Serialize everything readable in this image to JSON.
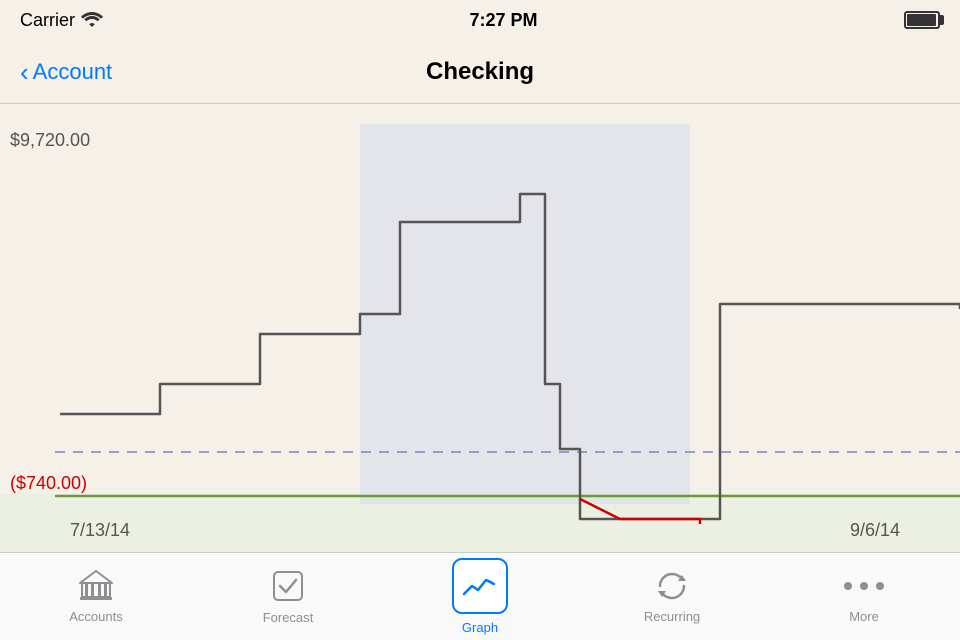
{
  "status": {
    "carrier": "Carrier",
    "wifi": "📶",
    "time": "7:27 PM"
  },
  "nav": {
    "back_label": "Account",
    "title": "Checking"
  },
  "chart": {
    "y_max": "$9,720.00",
    "y_min": "($740.00)",
    "x_start": "7/13/14",
    "x_end": "9/6/14"
  },
  "tabs": [
    {
      "id": "accounts",
      "label": "Accounts",
      "active": false
    },
    {
      "id": "forecast",
      "label": "Forecast",
      "active": false
    },
    {
      "id": "graph",
      "label": "Graph",
      "active": true
    },
    {
      "id": "recurring",
      "label": "Recurring",
      "active": false
    },
    {
      "id": "more",
      "label": "More",
      "active": false
    }
  ]
}
